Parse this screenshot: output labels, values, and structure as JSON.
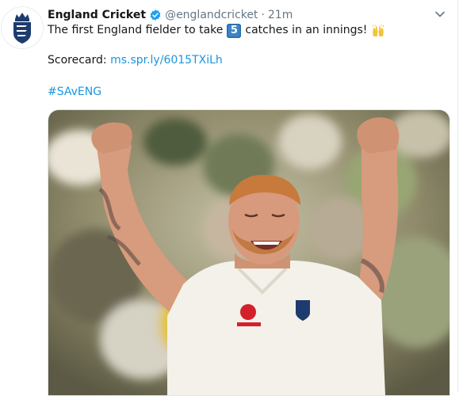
{
  "tweet": {
    "author_name": "England Cricket",
    "handle": "@englandcricket",
    "separator": "·",
    "timestamp": "21m",
    "text_before": "The first England fielder to take",
    "keycap_digit": "5",
    "text_after": "catches in an innings!",
    "scorecard_label": "Scorecard:",
    "scorecard_link": "ms.spr.ly/6015TXiLh",
    "hashtag": "#SAvENG"
  },
  "icons": {
    "avatar": "england-three-lions-crest",
    "verified": "verified-badge-icon",
    "menu": "chevron-down-icon",
    "emoji": "raising-hands-emoji"
  },
  "colors": {
    "link": "#1b95e0",
    "secondary_text": "#657786",
    "verified": "#1da1f2"
  }
}
